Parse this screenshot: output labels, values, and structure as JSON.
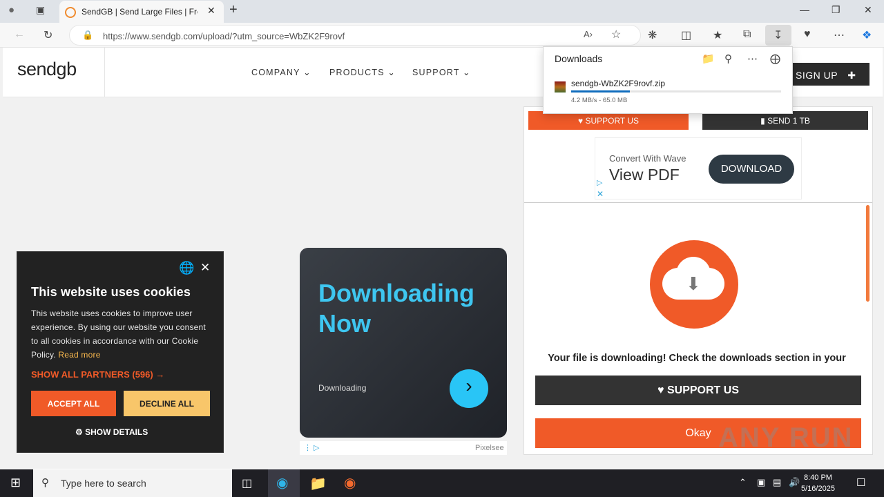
{
  "browser": {
    "tab_title": "SendGB | Send Large Files | Free f",
    "url": "https://www.sendgb.com/upload/?utm_source=WbZK2F9rovf"
  },
  "site": {
    "logo": "sendgb",
    "nav": [
      "COMPANY",
      "PRODUCTS",
      "SUPPORT"
    ],
    "signup": "SIGN UP"
  },
  "downloads": {
    "title": "Downloads",
    "filename": "sendgb-WbZK2F9rovf.zip",
    "status": "4.2 MB/s - 65.0 MB",
    "progress": 0.28
  },
  "panel": {
    "support_top": "SUPPORT US",
    "send1tb": "SEND 1 TB",
    "ad_line1": "Convert With Wave",
    "ad_line2": "View PDF",
    "ad_button": "DOWNLOAD",
    "message": "Your file is downloading! Check the downloads section in your",
    "support_big": "SUPPORT US",
    "okay": "Okay"
  },
  "cookie": {
    "title": "This website uses cookies",
    "body": "This website uses cookies to improve user experience. By using our website you consent to all cookies in accordance with our Cookie Policy.",
    "read_more": "Read more",
    "partners": "SHOW ALL PARTNERS (596) →",
    "accept": "ACCEPT ALL",
    "decline": "DECLINE ALL",
    "details": "SHOW DETAILS"
  },
  "ad2": {
    "title_line1": "Downloading",
    "title_line2": "Now",
    "subtitle": "Downloading",
    "footer": "Pixelsee"
  },
  "taskbar": {
    "search_placeholder": "Type here to search",
    "time": "8:40 PM",
    "date": "5/16/2025"
  },
  "watermark": "ANY RUN"
}
